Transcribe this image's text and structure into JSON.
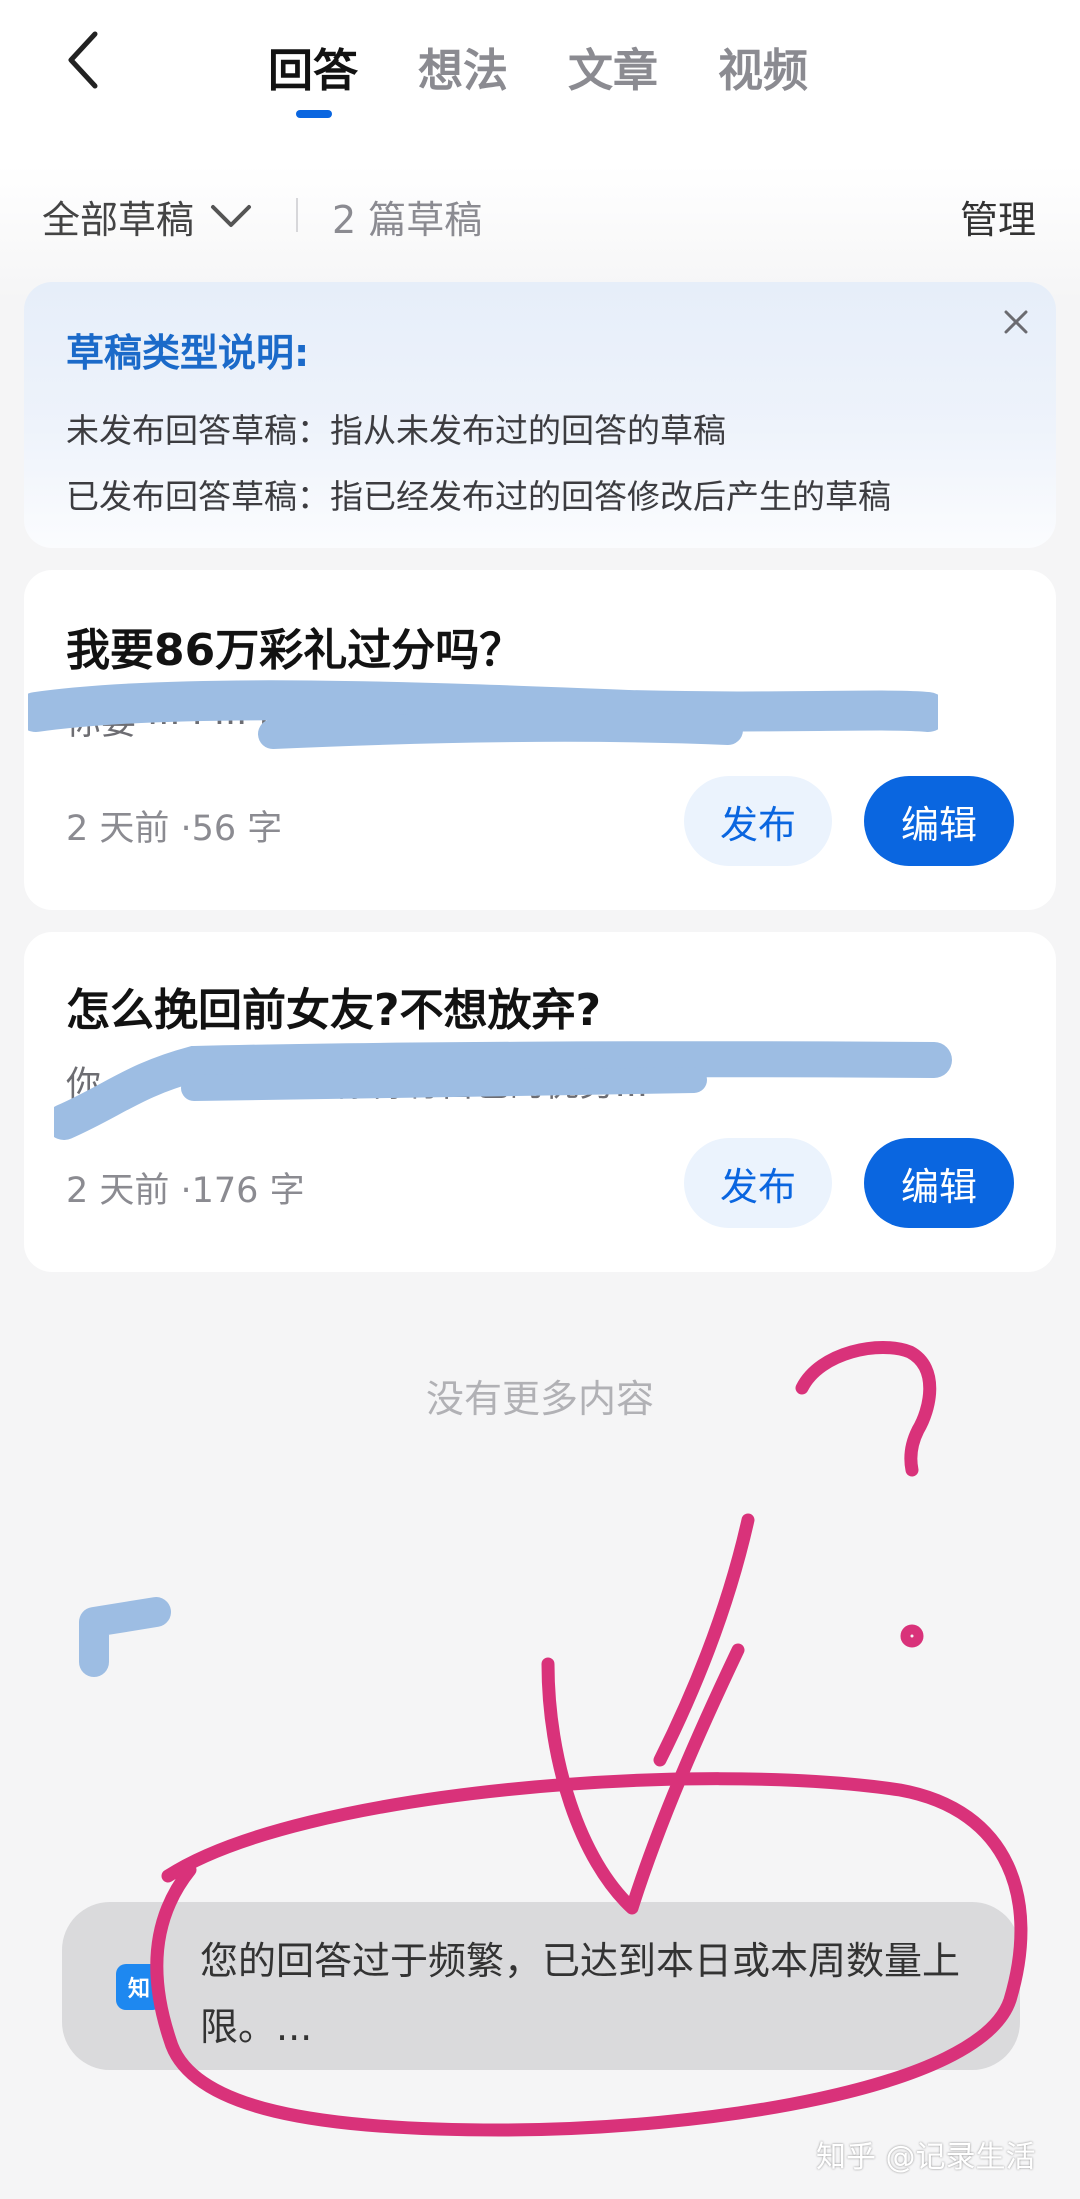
{
  "header": {
    "tabs": [
      {
        "label": "回答",
        "active": true
      },
      {
        "label": "想法",
        "active": false
      },
      {
        "label": "文章",
        "active": false
      },
      {
        "label": "视频",
        "active": false
      }
    ],
    "back_icon": "chevron-left-icon"
  },
  "filter": {
    "label": "全部草稿",
    "icon": "chevron-down-icon",
    "count_text": "2 篇草稿",
    "manage_label": "管理"
  },
  "info": {
    "title": "草稿类型说明:",
    "lines": [
      "未发布回答草稿：指从未发布过的回答的草稿",
      "已发布回答草稿：指已经发布过的回答修改后产生的草稿"
    ],
    "close_icon": "close-icon"
  },
  "drafts": [
    {
      "title": "我要86万彩礼过分吗？",
      "excerpt": "你要  ···  ·  ···  ·  ·  ·  ·  ···  的，等了...",
      "meta": "2 天前 ·56  字",
      "publish_label": "发布",
      "edit_label": "编辑"
    },
    {
      "title": "怎么挽回前女友?不想放弃?",
      "excerpt": "你  ·  ·  ·  ·  ·  ·  ·  ·  ·  ·  你得有自己的优势...",
      "meta": "2 天前 ·176  字",
      "publish_label": "发布",
      "edit_label": "编辑"
    }
  ],
  "footer": {
    "no_more": "没有更多内容"
  },
  "toast": {
    "icon_text": "知",
    "message": "您的回答过于频繁，已达到本日或本周数量上限。..."
  },
  "watermark": "知乎 @记录生活",
  "colors": {
    "accent": "#0a66e0",
    "info_title": "#1b6ac9",
    "annotation_pink": "#d9327a",
    "redaction_blue": "#9dbde3"
  }
}
